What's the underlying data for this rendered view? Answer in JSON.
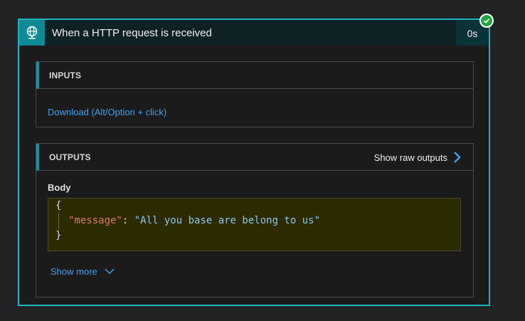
{
  "header": {
    "title": "When a HTTP request is received",
    "duration": "0s",
    "trigger_icon": "globe-request-icon",
    "status_icon": "success-check-icon"
  },
  "inputs": {
    "label": "INPUTS",
    "download_link": "Download (Alt/Option + click)"
  },
  "outputs": {
    "label": "OUTPUTS",
    "show_raw": "Show raw outputs",
    "body_label": "Body",
    "code": {
      "open_brace": "{",
      "key": "\"message\"",
      "colon": ": ",
      "value": "\"All you base are belong to us\"",
      "close_brace": "}"
    },
    "show_more": "Show more"
  },
  "colors": {
    "accent": "#1fb3c2",
    "link": "#3ea2f0",
    "success": "#22a544",
    "code_background": "#2b2a00"
  }
}
